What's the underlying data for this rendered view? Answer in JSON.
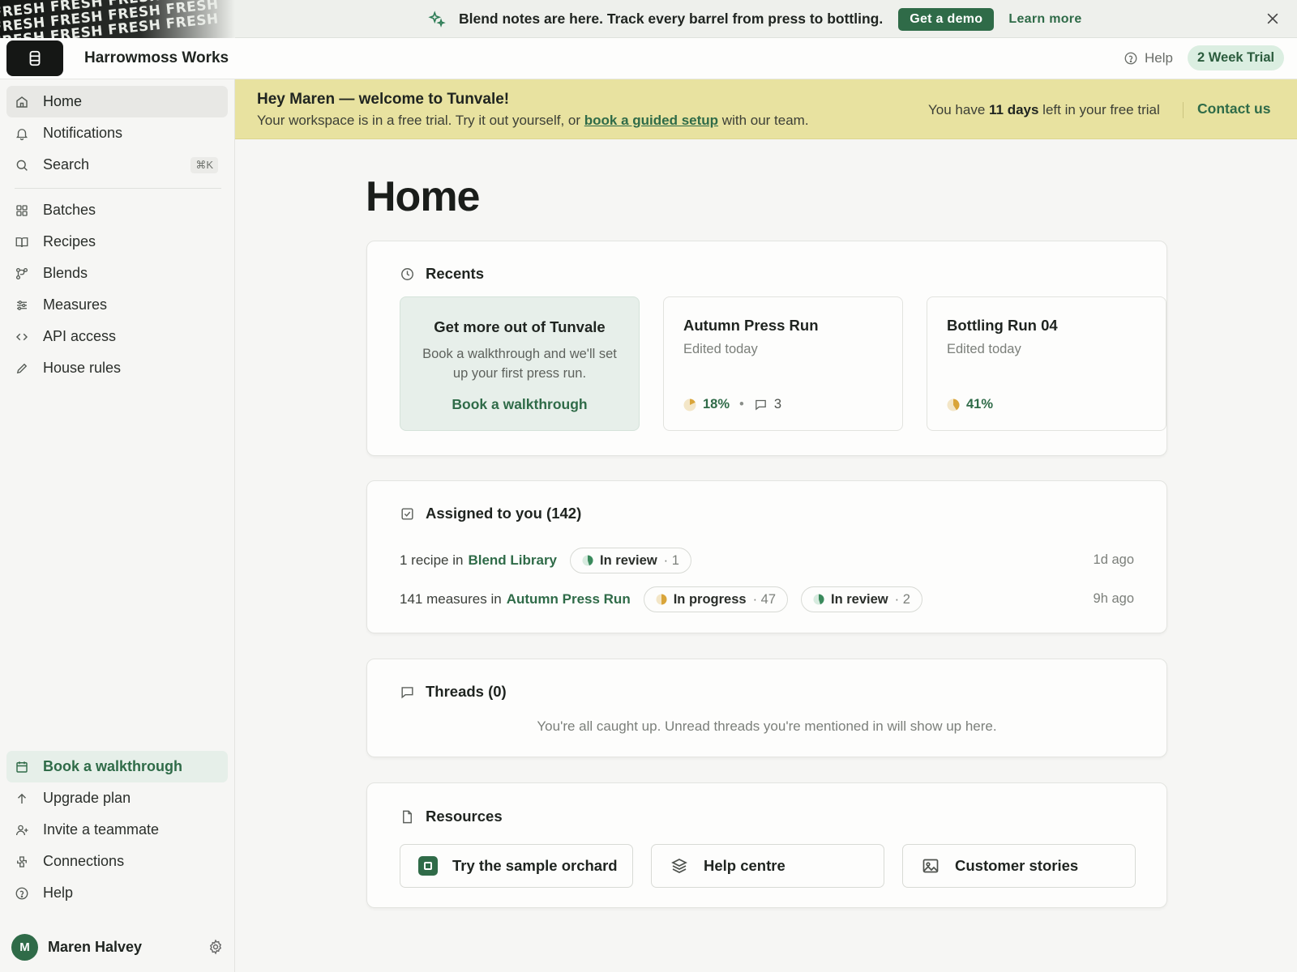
{
  "announcement": {
    "art_text": "FRESH FRESH FRESH FRESH",
    "message": "Blend notes are here. Track every barrel from press to bottling.",
    "demo_label": "Get a demo",
    "learn_label": "Learn more",
    "icon": "sparkle-icon"
  },
  "header": {
    "workspace": "Harrowmoss Works",
    "help_label": "Help",
    "trial_badge": "2 Week Trial"
  },
  "sidebar": {
    "primary": [
      {
        "label": "Home",
        "icon": "home-icon",
        "active": true
      },
      {
        "label": "Notifications",
        "icon": "bell-icon"
      },
      {
        "label": "Search",
        "icon": "search-icon",
        "shortcut": "⌘K"
      }
    ],
    "sections": [
      {
        "label": "Batches",
        "icon": "grid-icon"
      },
      {
        "label": "Recipes",
        "icon": "book-icon"
      },
      {
        "label": "Blends",
        "icon": "branch-icon"
      },
      {
        "label": "Measures",
        "icon": "sliders-icon"
      },
      {
        "label": "API access",
        "icon": "code-icon"
      },
      {
        "label": "House rules",
        "icon": "pencil-icon"
      }
    ],
    "footer": [
      {
        "label": "Book a walkthrough",
        "icon": "calendar-icon",
        "accent": true
      },
      {
        "label": "Upgrade plan",
        "icon": "arrow-up-icon"
      },
      {
        "label": "Invite a teammate",
        "icon": "user-plus-icon"
      },
      {
        "label": "Connections",
        "icon": "connections-icon"
      },
      {
        "label": "Help",
        "icon": "help-circle-icon"
      }
    ],
    "user": {
      "initial": "M",
      "name": "Maren Halvey"
    }
  },
  "welcome": {
    "title": "Hey Maren — welcome to Tunvale!",
    "sub_before": "Your workspace is in a free trial. Try it out yourself, or ",
    "sub_link": "book a guided setup",
    "sub_after": " with our team.",
    "trial_before": "You have ",
    "trial_days": "11 days",
    "trial_after": " left in your free trial",
    "contact_label": "Contact us"
  },
  "page": {
    "title": "Home"
  },
  "recents": {
    "title": "Recents",
    "promo": {
      "title": "Get more out of Tunvale",
      "body": "Book a walkthrough and we'll set up your first press run.",
      "link": "Book a walkthrough"
    },
    "items": [
      {
        "title": "Autumn Press Run",
        "subtitle": "Edited today",
        "progress": "18%",
        "progress_value": 0.18,
        "comments": "3"
      },
      {
        "title": "Bottling Run 04",
        "subtitle": "Edited today",
        "progress": "41%",
        "progress_value": 0.41
      }
    ]
  },
  "assigned": {
    "title": "Assigned to you (142)",
    "rows": [
      {
        "prefix": "1 recipe in",
        "link": "Blend Library",
        "pills": [
          {
            "label": "In review",
            "count": "· 1",
            "status": "review"
          }
        ],
        "ago": "1d ago"
      },
      {
        "prefix": "141 measures in",
        "link": "Autumn Press Run",
        "pills": [
          {
            "label": "In progress",
            "count": "· 47",
            "status": "progress"
          },
          {
            "label": "In review",
            "count": "· 2",
            "status": "review"
          }
        ],
        "ago": "9h ago"
      }
    ]
  },
  "threads": {
    "title": "Threads (0)",
    "empty": "You're all caught up. Unread threads you're mentioned in will show up here."
  },
  "resources": {
    "title": "Resources",
    "items": [
      {
        "label": "Try the sample orchard",
        "icon": "sample-icon"
      },
      {
        "label": "Help centre",
        "icon": "layers-icon"
      },
      {
        "label": "Customer stories",
        "icon": "image-icon"
      }
    ]
  },
  "colors": {
    "accent": "#2f6b48",
    "banner": "#e8e2a0",
    "progress_pie": "#d9a53a",
    "review_pie": "#3a8a5c"
  }
}
